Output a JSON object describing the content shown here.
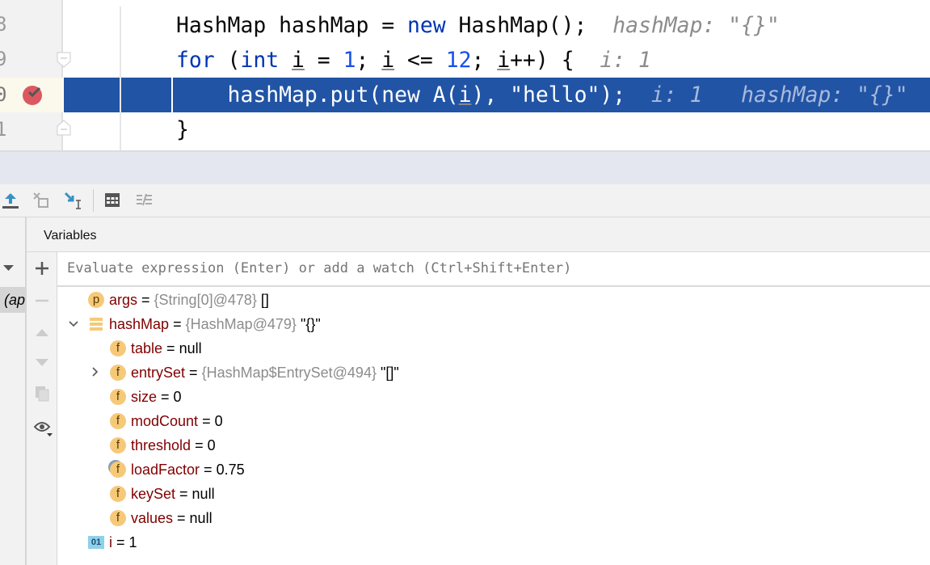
{
  "editor": {
    "line_numbers": [
      "8",
      "9",
      "0",
      "1"
    ],
    "lines": [
      {
        "tokens": [
          {
            "t": "HashMap hashMap = "
          },
          {
            "t": "new",
            "c": "kw"
          },
          {
            "t": " HashMap();  "
          },
          {
            "t": "hashMap: \"{}\"",
            "c": "hint"
          }
        ]
      },
      {
        "tokens": [
          {
            "t": "for",
            "c": "kw"
          },
          {
            "t": " ("
          },
          {
            "t": "int",
            "c": "kw"
          },
          {
            "t": " "
          },
          {
            "t": "i",
            "c": "u"
          },
          {
            "t": " = "
          },
          {
            "t": "1",
            "c": "num"
          },
          {
            "t": "; "
          },
          {
            "t": "i",
            "c": "u"
          },
          {
            "t": " <= "
          },
          {
            "t": "12",
            "c": "num"
          },
          {
            "t": "; "
          },
          {
            "t": "i",
            "c": "u"
          },
          {
            "t": "++) {  "
          },
          {
            "t": "i: 1",
            "c": "hint"
          }
        ]
      },
      {
        "tokens": [
          {
            "t": "    hashMap.put("
          },
          {
            "t": "new",
            "c": "kw"
          },
          {
            "t": " A("
          },
          {
            "t": "i",
            "c": "u"
          },
          {
            "t": "), "
          },
          {
            "t": "\"hello\"",
            "c": "str"
          },
          {
            "t": ");  "
          },
          {
            "t": "i: 1   hashMap: \"{}\"",
            "c": "hint"
          }
        ]
      },
      {
        "tokens": [
          {
            "t": "}"
          }
        ]
      }
    ],
    "current_line_color": "#2154a5",
    "breakpoint_color": "#db5860"
  },
  "frames": {
    "selected": "ap)"
  },
  "variables": {
    "title": "Variables",
    "eval_placeholder": "Evaluate expression (Enter) or add a watch (Ctrl+Shift+Enter)",
    "tree": [
      {
        "icon": "p",
        "name": "args",
        "eq": " = ",
        "type": "{String[0]@478}",
        "value": " []",
        "level": 0
      },
      {
        "icon": "obj",
        "name": "hashMap",
        "eq": " = ",
        "type": "{HashMap@479}",
        "value": " \"{}\"",
        "level": 0,
        "expanded": true
      },
      {
        "icon": "f",
        "name": "table",
        "eq": " = ",
        "type": "",
        "value": "null",
        "level": 1
      },
      {
        "icon": "f",
        "name": "entrySet",
        "eq": " = ",
        "type": "{HashMap$EntrySet@494}",
        "value": " \"[]\"",
        "level": 1,
        "collapsed": true
      },
      {
        "icon": "f",
        "name": "size",
        "eq": " = ",
        "type": "",
        "value": "0",
        "level": 1
      },
      {
        "icon": "f",
        "name": "modCount",
        "eq": " = ",
        "type": "",
        "value": "0",
        "level": 1
      },
      {
        "icon": "f",
        "name": "threshold",
        "eq": " = ",
        "type": "",
        "value": "0",
        "level": 1
      },
      {
        "icon": "f-final",
        "name": "loadFactor",
        "eq": " = ",
        "type": "",
        "value": "0.75",
        "level": 1
      },
      {
        "icon": "f",
        "name": "keySet",
        "eq": " = ",
        "type": "",
        "value": "null",
        "level": 1
      },
      {
        "icon": "f",
        "name": "values",
        "eq": " = ",
        "type": "",
        "value": "null",
        "level": 1
      },
      {
        "icon": "01",
        "name": "i",
        "eq": " = ",
        "type": "",
        "value": "1",
        "level": 0
      }
    ]
  }
}
